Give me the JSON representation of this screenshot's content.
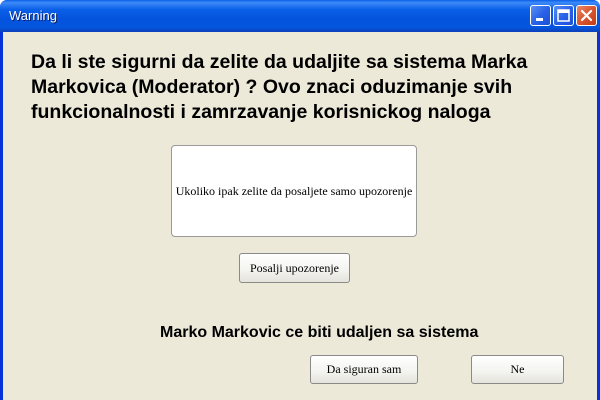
{
  "window": {
    "title": "Warning",
    "controls": [
      "minimize-icon",
      "maximize-icon",
      "close-icon"
    ]
  },
  "dialog": {
    "question": "Da li ste sigurni da zelite da udaljite sa sistema Marka Markovica (Moderator) ?  Ovo znaci oduzimanje svih funkcionalnosti i zamrzavanje korisnickog naloga",
    "warning_note": "Ukoliko ipak zelite da posaljete samo upozorenje",
    "send_warning_label": "Posalji upozorenje",
    "removal_statement": "Marko Markovic ce biti udaljen sa sistema",
    "confirm_label": "Da siguran sam",
    "cancel_label": "Ne"
  },
  "colors": {
    "titlebar": "#0a5fe8",
    "window_background": "#ece9d8",
    "close_button": "#dc5a32"
  }
}
